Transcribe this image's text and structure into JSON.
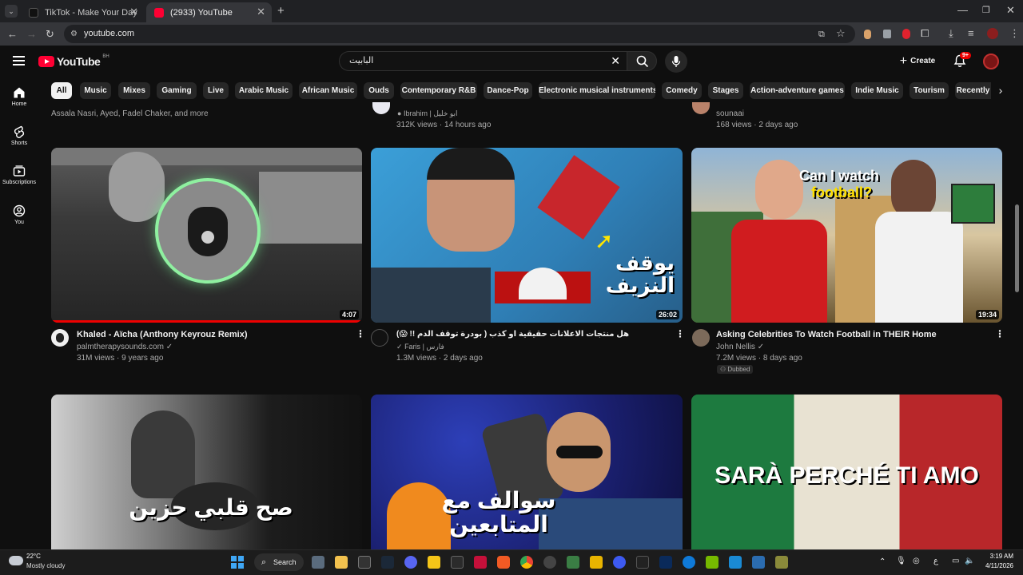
{
  "browser": {
    "tabs": [
      {
        "label": "TikTok - Make Your Day"
      },
      {
        "label": "(2933) YouTube"
      }
    ],
    "url": "youtube.com"
  },
  "header": {
    "logo_text": "YouTube",
    "region": "BH",
    "search_value": "البابيت",
    "create_label": "Create",
    "notif_badge": "9+"
  },
  "sidebar": [
    {
      "label": "Home"
    },
    {
      "label": "Shorts"
    },
    {
      "label": "Subscriptions"
    },
    {
      "label": "You"
    }
  ],
  "chips": [
    "All",
    "Music",
    "Mixes",
    "Gaming",
    "Live",
    "Arabic Music",
    "African Music",
    "Ouds",
    "Contemporary R&B",
    "Dance-Pop",
    "Electronic musical instruments",
    "Comedy",
    "Stages",
    "Action-adventure games",
    "Indie Music",
    "Tourism",
    "Recently"
  ],
  "top_row": [
    {
      "meta1": "Assala Nasri, Ayed, Fadel Chaker, and more"
    },
    {
      "channel": "Ibrahim | ابو خليل",
      "meta": "312K views · 14 hours ago"
    },
    {
      "channel": "sounaai",
      "meta": "168 views · 2 days ago"
    }
  ],
  "videos": [
    {
      "title": "Khaled - Aïcha (Anthony Keyrouz Remix)",
      "channel": "palmtherapysounds.com",
      "meta": "31M views · 9 years ago",
      "duration": "4:07"
    },
    {
      "title": "هل منتجات الاعلانات حقيقية او كذب ( بودرة توقف الدم !! 😱)",
      "channel": "Faris | فارس",
      "meta": "1.3M views · 2 days ago",
      "duration": "26:02",
      "thumb_text": "يوقف النزيف"
    },
    {
      "title": "Asking Celebrities To Watch Football in THEIR Home",
      "channel": "John Nellis",
      "meta": "7.2M views · 8 days ago",
      "badge": "Dubbed",
      "duration": "19:34",
      "thumb_text1": "Can I watch",
      "thumb_text2": "football?"
    }
  ],
  "bottom_row": [
    {
      "thumb_text": "صح قلبي حزين"
    },
    {
      "thumb_text": "سوالف مع المتابعين"
    },
    {
      "thumb_text": "SARÀ PERCHÉ TI AMO"
    }
  ],
  "taskbar": {
    "weather_temp": "22°C",
    "weather_desc": "Mostly cloudy",
    "search_label": "Search",
    "time": "3:19 AM",
    "date": "4/11/2026",
    "lang": "ع"
  }
}
